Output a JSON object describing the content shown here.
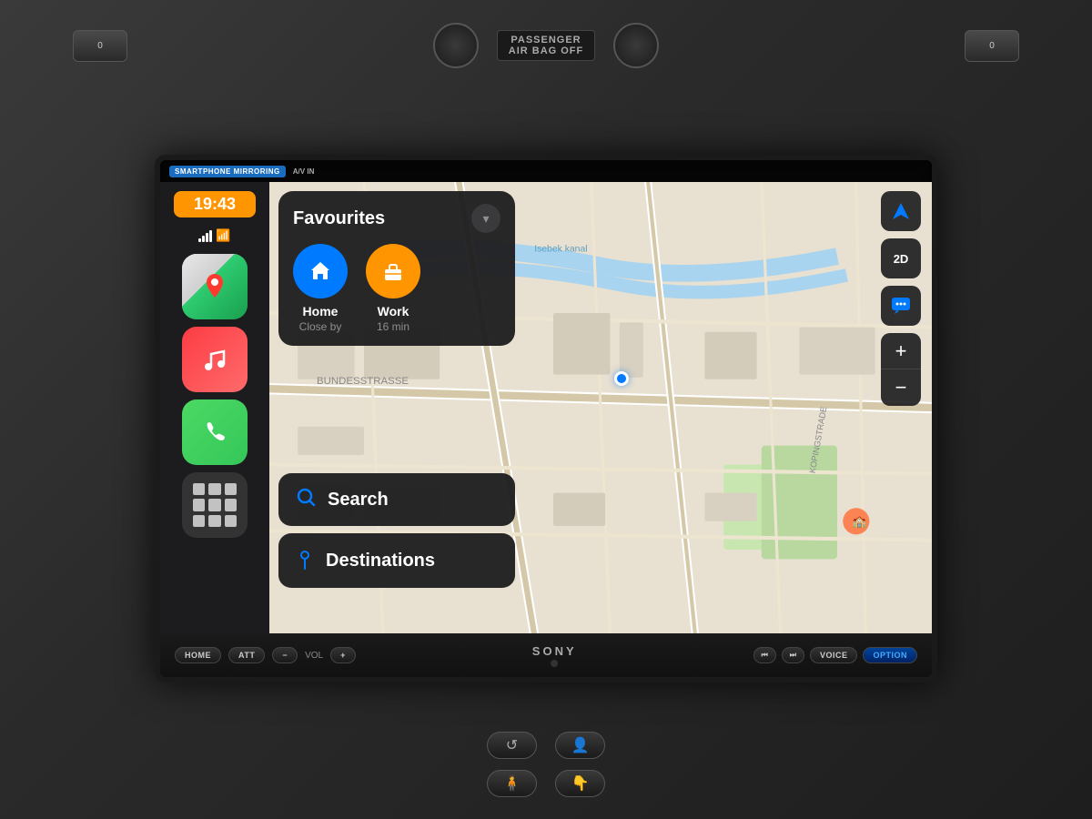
{
  "status_bar": {
    "mirroring_label": "SMARTPHONE MIRRORING",
    "avin_label": "A/V IN"
  },
  "sidebar": {
    "time": "19:43",
    "apps": [
      {
        "name": "Maps",
        "icon": "maps"
      },
      {
        "name": "Music",
        "icon": "music"
      },
      {
        "name": "Phone",
        "icon": "phone"
      },
      {
        "name": "Apps",
        "icon": "grid"
      }
    ]
  },
  "favourites_panel": {
    "title": "Favourites",
    "chevron": "▾",
    "items": [
      {
        "icon": "🏠",
        "label": "Home",
        "sublabel": "Close by",
        "type": "home"
      },
      {
        "icon": "💼",
        "label": "Work",
        "sublabel": "16 min",
        "type": "work"
      }
    ]
  },
  "action_buttons": [
    {
      "label": "Search",
      "icon": "search"
    },
    {
      "label": "Destinations",
      "icon": "pin"
    }
  ],
  "map_controls": {
    "location_arrow": "➤",
    "view_2d": "2D",
    "chat_icon": "💬",
    "zoom_in": "+",
    "zoom_out": "−"
  },
  "sony_bar": {
    "home_btn": "HOME",
    "att_btn": "ATT",
    "vol_minus": "−",
    "vol_label": "VOL",
    "vol_plus": "+",
    "brand": "SONY",
    "prev_btn": "⏮",
    "next_btn": "⏭",
    "voice_btn": "VOICE",
    "option_btn": "OPTION"
  },
  "airbag": {
    "line1": "PASSENGER",
    "line2": "AIR BAG OFF"
  },
  "colors": {
    "accent_blue": "#007aff",
    "home_icon_bg": "#007aff",
    "work_icon_bg": "#ff9500",
    "time_bg": "#ff9500",
    "panel_bg": "rgba(28,28,30,0.95)",
    "sidebar_bg": "#1c1c1e"
  }
}
